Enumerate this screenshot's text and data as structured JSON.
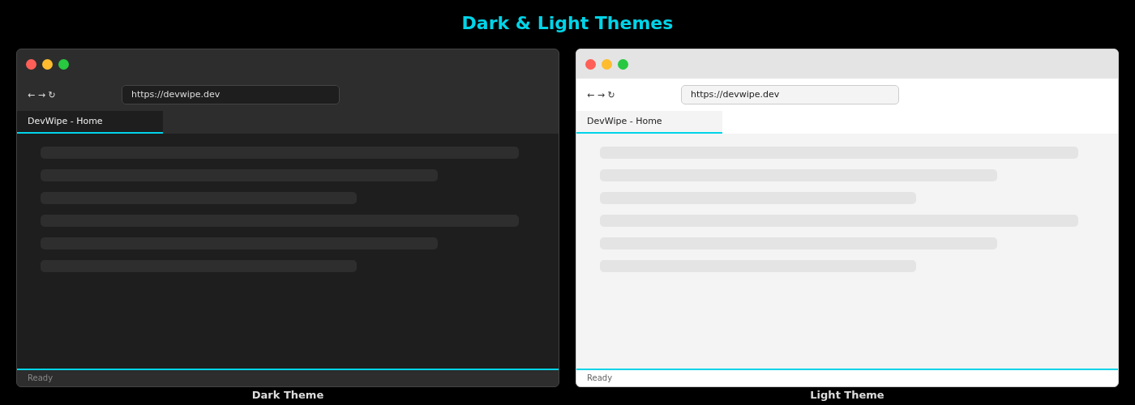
{
  "title": "Dark & Light Themes",
  "windows": [
    {
      "kind": "dark",
      "nav": "← → ↻",
      "url": "https://devwipe.dev",
      "tabs": [
        {
          "label": "DevWipe - Home",
          "selected": true
        }
      ],
      "status": "Ready",
      "caption": "Dark Theme"
    },
    {
      "kind": "light",
      "nav": "← → ↻",
      "url": "https://devwipe.dev",
      "tabs": [
        {
          "label": "DevWipe - Home",
          "selected": true
        }
      ],
      "status": "Ready",
      "caption": "Light Theme"
    }
  ]
}
